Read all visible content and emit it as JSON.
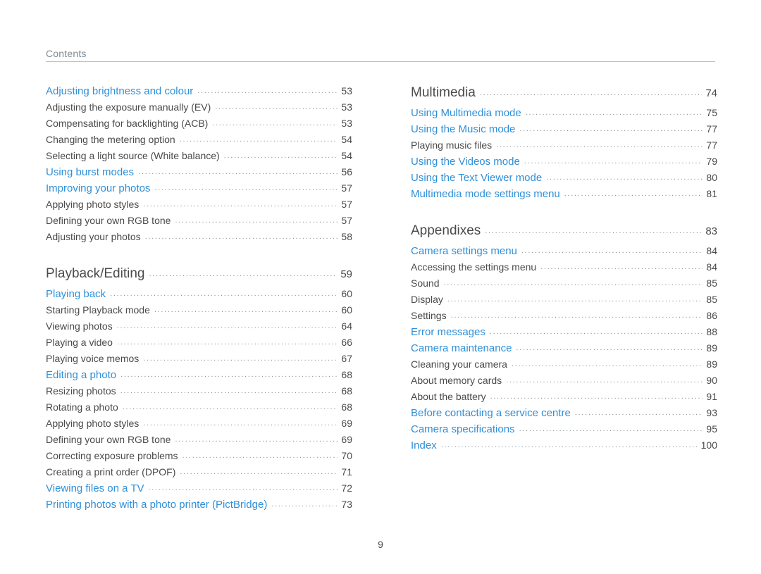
{
  "header": {
    "title": "Contents"
  },
  "footer": {
    "page_number": "9"
  },
  "columns": {
    "left": [
      {
        "entries": [
          {
            "level": "h2",
            "label": "Adjusting brightness and colour",
            "page": "53"
          },
          {
            "level": "h3",
            "label": "Adjusting the exposure manually (EV)",
            "page": "53"
          },
          {
            "level": "h3",
            "label": "Compensating for backlighting (ACB)",
            "page": "53"
          },
          {
            "level": "h3",
            "label": "Changing the metering option",
            "page": "54"
          },
          {
            "level": "h3",
            "label": "Selecting a light source (White balance)",
            "page": "54"
          },
          {
            "level": "h2",
            "label": "Using burst modes",
            "page": "56"
          },
          {
            "level": "h2",
            "label": "Improving your photos",
            "page": "57"
          },
          {
            "level": "h3",
            "label": "Applying photo styles",
            "page": "57"
          },
          {
            "level": "h3",
            "label": "Defining your own RGB tone",
            "page": "57"
          },
          {
            "level": "h3",
            "label": "Adjusting your photos",
            "page": "58"
          }
        ]
      },
      {
        "entries": [
          {
            "level": "h1",
            "label": "Playback/Editing",
            "page": "59"
          },
          {
            "level": "h2",
            "label": "Playing back",
            "page": "60"
          },
          {
            "level": "h3",
            "label": "Starting Playback mode",
            "page": "60"
          },
          {
            "level": "h3",
            "label": "Viewing photos",
            "page": "64"
          },
          {
            "level": "h3",
            "label": "Playing a video",
            "page": "66"
          },
          {
            "level": "h3",
            "label": "Playing voice memos",
            "page": "67"
          },
          {
            "level": "h2",
            "label": "Editing a photo",
            "page": "68"
          },
          {
            "level": "h3",
            "label": "Resizing photos",
            "page": "68"
          },
          {
            "level": "h3",
            "label": "Rotating a photo",
            "page": "68"
          },
          {
            "level": "h3",
            "label": "Applying photo styles",
            "page": "69"
          },
          {
            "level": "h3",
            "label": "Defining your own RGB tone",
            "page": "69"
          },
          {
            "level": "h3",
            "label": "Correcting exposure problems",
            "page": "70"
          },
          {
            "level": "h3",
            "label": "Creating a print order (DPOF)",
            "page": "71"
          },
          {
            "level": "h2",
            "label": "Viewing files on a TV",
            "page": "72"
          },
          {
            "level": "h2",
            "label": "Printing photos with a photo printer (PictBridge)",
            "page": "73"
          }
        ]
      }
    ],
    "right": [
      {
        "entries": [
          {
            "level": "h1",
            "label": "Multimedia",
            "page": "74"
          },
          {
            "level": "h2",
            "label": "Using Multimedia mode",
            "page": "75"
          },
          {
            "level": "h2",
            "label": "Using the Music mode",
            "page": "77"
          },
          {
            "level": "h3",
            "label": "Playing music files",
            "page": "77"
          },
          {
            "level": "h2",
            "label": "Using the Videos mode",
            "page": "79"
          },
          {
            "level": "h2",
            "label": "Using the Text Viewer mode",
            "page": "80"
          },
          {
            "level": "h2",
            "label": "Multimedia mode settings menu",
            "page": "81"
          }
        ]
      },
      {
        "entries": [
          {
            "level": "h1",
            "label": "Appendixes",
            "page": "83"
          },
          {
            "level": "h2",
            "label": "Camera settings menu",
            "page": "84"
          },
          {
            "level": "h3",
            "label": "Accessing the settings menu",
            "page": "84"
          },
          {
            "level": "h3",
            "label": "Sound",
            "page": "85"
          },
          {
            "level": "h3",
            "label": "Display",
            "page": "85"
          },
          {
            "level": "h3",
            "label": "Settings",
            "page": "86"
          },
          {
            "level": "h2",
            "label": "Error messages",
            "page": "88"
          },
          {
            "level": "h2",
            "label": "Camera maintenance",
            "page": "89"
          },
          {
            "level": "h3",
            "label": "Cleaning your camera",
            "page": "89"
          },
          {
            "level": "h3",
            "label": "About memory cards",
            "page": "90"
          },
          {
            "level": "h3",
            "label": "About the battery",
            "page": "91"
          },
          {
            "level": "h2",
            "label": "Before contacting a service centre",
            "page": "93"
          },
          {
            "level": "h2",
            "label": "Camera specifications",
            "page": "95"
          },
          {
            "level": "h2",
            "label": "Index",
            "page": "100"
          }
        ]
      }
    ]
  }
}
